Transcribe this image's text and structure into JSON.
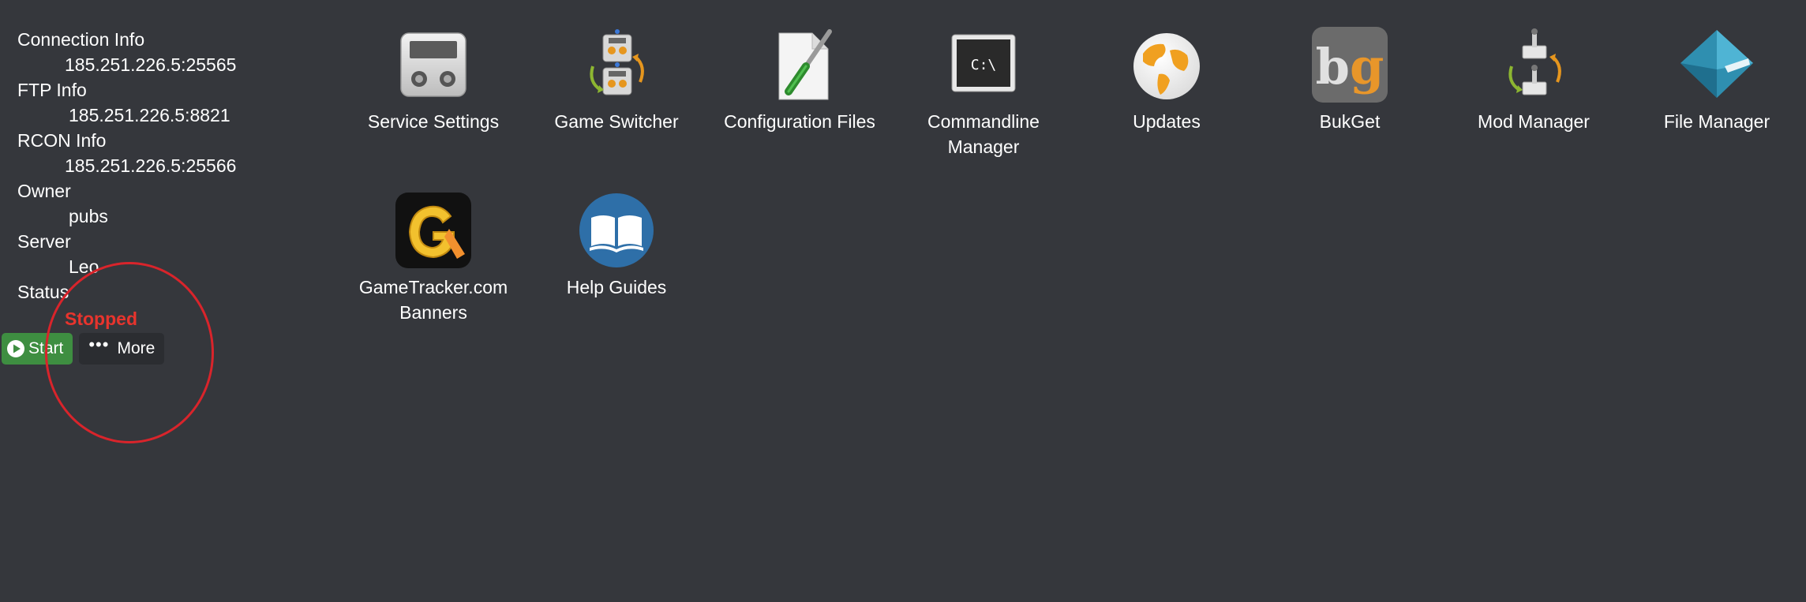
{
  "info": {
    "connection_label": "Connection Info",
    "connection_value": "185.251.226.5:25565",
    "ftp_label": "FTP Info",
    "ftp_value": "185.251.226.5:8821",
    "rcon_label": "RCON Info",
    "rcon_value": "185.251.226.5:25566",
    "owner_label": "Owner",
    "owner_value": "pubs",
    "server_label": "Server",
    "server_value": "Leo",
    "status_label": "Status",
    "status_value": "Stopped",
    "status_color": "#e8342d"
  },
  "actions": {
    "start_label": "Start",
    "more_label": "More",
    "start_color": "#3e8e41"
  },
  "tiles": [
    {
      "label": "Service Settings",
      "icon": "service-settings-icon"
    },
    {
      "label": "Game Switcher",
      "icon": "game-switcher-icon"
    },
    {
      "label": "Configuration Files",
      "icon": "configuration-files-icon"
    },
    {
      "label": "Commandline Manager",
      "icon": "commandline-icon"
    },
    {
      "label": "Updates",
      "icon": "globe-icon"
    },
    {
      "label": "BukGet",
      "icon": "bukget-icon",
      "icon_text": "bg"
    },
    {
      "label": "Mod Manager",
      "icon": "mod-manager-icon"
    },
    {
      "label": "File Manager",
      "icon": "file-manager-icon"
    },
    {
      "label": "GameTracker.com Banners",
      "icon": "gametracker-icon"
    },
    {
      "label": "Help Guides",
      "icon": "book-icon"
    }
  ],
  "commandline_icon_text": "C:\\",
  "annotation_color": "#d9242b"
}
